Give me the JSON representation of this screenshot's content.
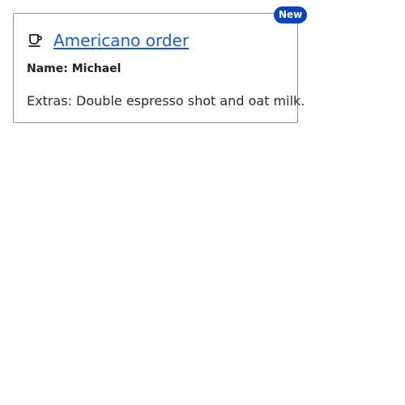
{
  "card": {
    "badge": "New",
    "icon": "coffee-cup-icon",
    "title": "Americano order",
    "name_line": "Name: Michael",
    "extras_line": "Extras: Double espresso shot and oat milk.",
    "colors": {
      "badge_bg": "#0b46b8",
      "link": "#1a5bbf",
      "border": "#8f8f8f"
    }
  }
}
